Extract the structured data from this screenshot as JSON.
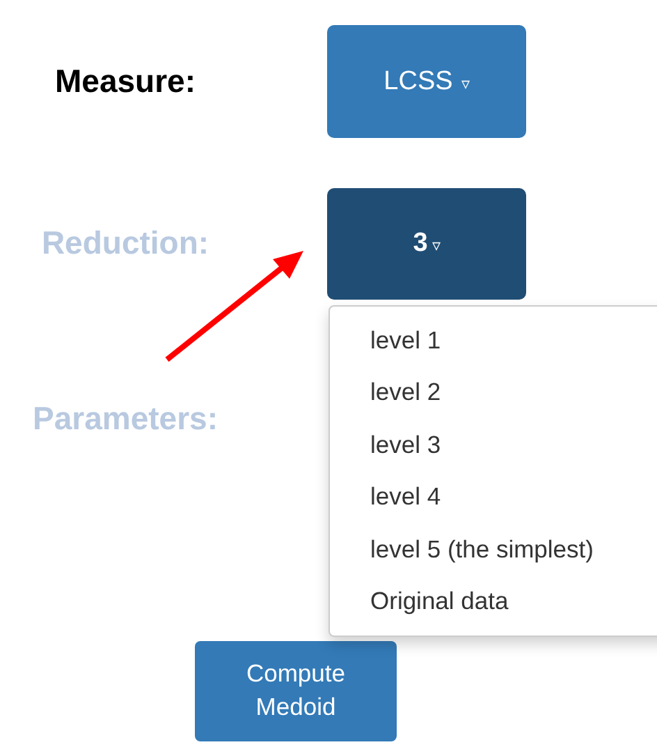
{
  "rows": [
    {
      "label": "Measure:",
      "dimmed": false,
      "button": {
        "value": "LCSS",
        "caret": "▿",
        "open": false
      }
    },
    {
      "label": "Reduction:",
      "dimmed": true,
      "button": {
        "value": "3",
        "caret": "▿",
        "open": true
      }
    },
    {
      "label": "Parameters:",
      "dimmed": true
    }
  ],
  "dropdown": {
    "items": [
      "level 1",
      "level 2",
      "level 3",
      "level 4",
      "level 5 (the simplest)",
      "Original data"
    ]
  },
  "compute_button": {
    "lines": [
      "Compute",
      "Medoid"
    ]
  }
}
